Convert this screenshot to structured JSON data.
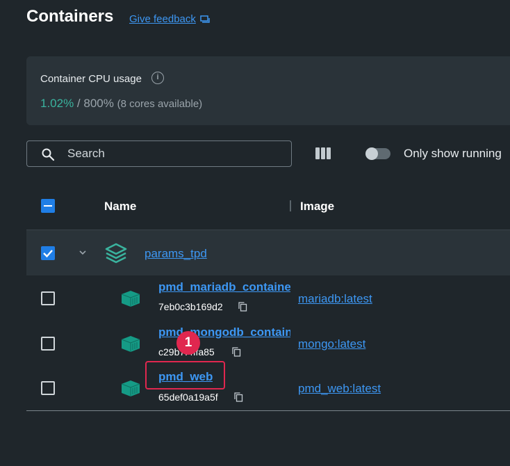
{
  "header": {
    "title": "Containers",
    "feedback_label": "Give feedback"
  },
  "cpu": {
    "label": "Container CPU usage",
    "used": "1.02%",
    "separator": " / ",
    "total": "800%",
    "cores": "(8 cores available)"
  },
  "toolbar": {
    "search_placeholder": "Search",
    "toggle_label": "Only show running",
    "toggle_on": false
  },
  "table": {
    "columns": {
      "name": "Name",
      "image": "Image"
    },
    "group": {
      "name": "params_tpd",
      "checked": true,
      "expanded": true
    },
    "rows": [
      {
        "name": "pmd_mariadb_containe",
        "id": "7eb0c3b169d2",
        "image": "mariadb:latest",
        "checked": false
      },
      {
        "name": "pmd_mongodb_contain",
        "id": "c29b7f4ffa85",
        "image": "mongo:latest",
        "checked": false
      },
      {
        "name": "pmd_web",
        "id": "65def0a19a5f",
        "image": "pmd_web:latest",
        "checked": false
      }
    ]
  },
  "annotation": {
    "step_number": "1"
  },
  "colors": {
    "background": "#1f262b",
    "card": "#2a3339",
    "link": "#3d97f3",
    "accent_green": "#3ab39e",
    "checkbox_blue": "#1f7ee6",
    "highlight_red": "#e0274f"
  },
  "icons": {
    "feedback": "message-square-icon",
    "info": "info-circle-icon",
    "search": "magnifier-icon",
    "columns": "column-layout-icon",
    "chevron": "chevron-down-icon",
    "stack": "compose-stack-icon",
    "container": "container-icon",
    "copy": "copy-icon"
  }
}
